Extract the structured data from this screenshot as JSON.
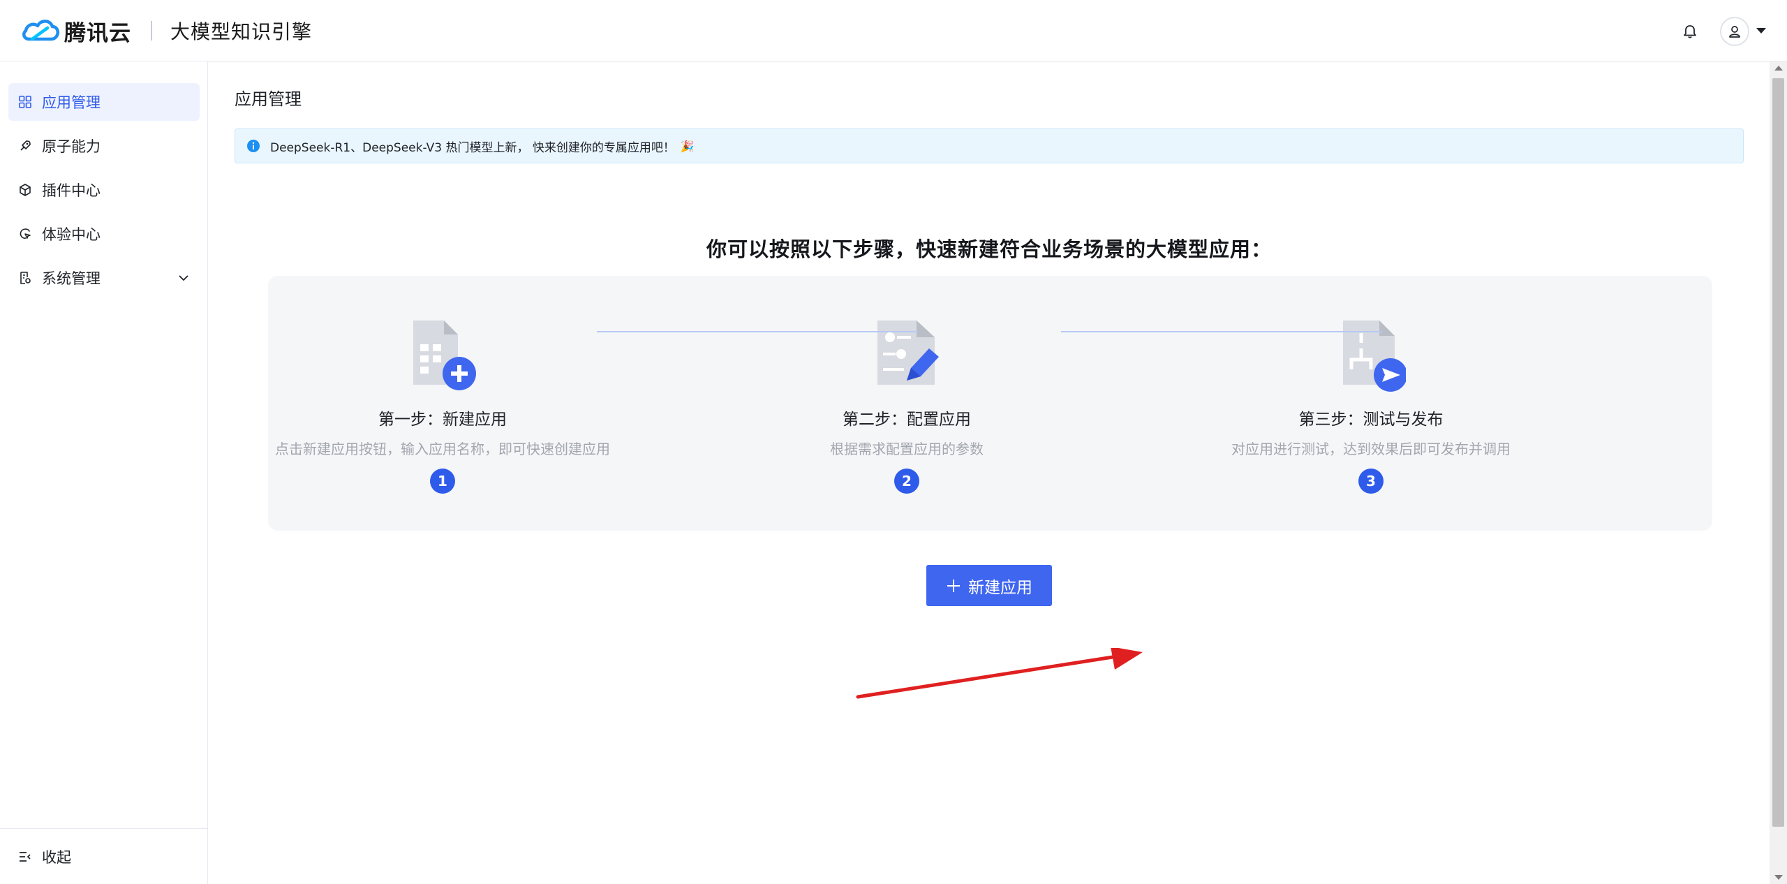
{
  "header": {
    "brand_name": "腾讯云",
    "product_name": "大模型知识引擎",
    "icons": {
      "logo": "tencent-cloud-logo",
      "bell": "bell-icon",
      "avatar": "user-icon",
      "caret": "caret-down-icon"
    }
  },
  "sidebar": {
    "items": [
      {
        "label": "应用管理",
        "icon": "grid-icon",
        "active": true
      },
      {
        "label": "原子能力",
        "icon": "rocket-icon",
        "active": false
      },
      {
        "label": "插件中心",
        "icon": "cube-icon",
        "active": false
      },
      {
        "label": "体验中心",
        "icon": "experience-icon",
        "active": false
      },
      {
        "label": "系统管理",
        "icon": "system-icon",
        "active": false,
        "has_submenu": true
      }
    ],
    "collapse_label": "收起"
  },
  "main": {
    "page_title": "应用管理",
    "notice_text": "DeepSeek-R1、DeepSeek-V3 热门模型上新， 快来创建你的专属应用吧！",
    "notice_emoji": "🎉",
    "headline": "你可以按照以下步骤，快速新建符合业务场景的大模型应用：",
    "steps": [
      {
        "number": "1",
        "title": "第一步：新建应用",
        "desc": "点击新建应用按钮，输入应用名称，即可快速创建应用"
      },
      {
        "number": "2",
        "title": "第二步：配置应用",
        "desc": "根据需求配置应用的参数"
      },
      {
        "number": "3",
        "title": "第三步：测试与发布",
        "desc": "对应用进行测试，达到效果后即可发布并调用"
      }
    ],
    "new_app_button": "新建应用"
  },
  "colors": {
    "accent": "#3f66ef",
    "active_nav_bg": "#eef2ff",
    "annotation_arrow": "#e02020"
  }
}
